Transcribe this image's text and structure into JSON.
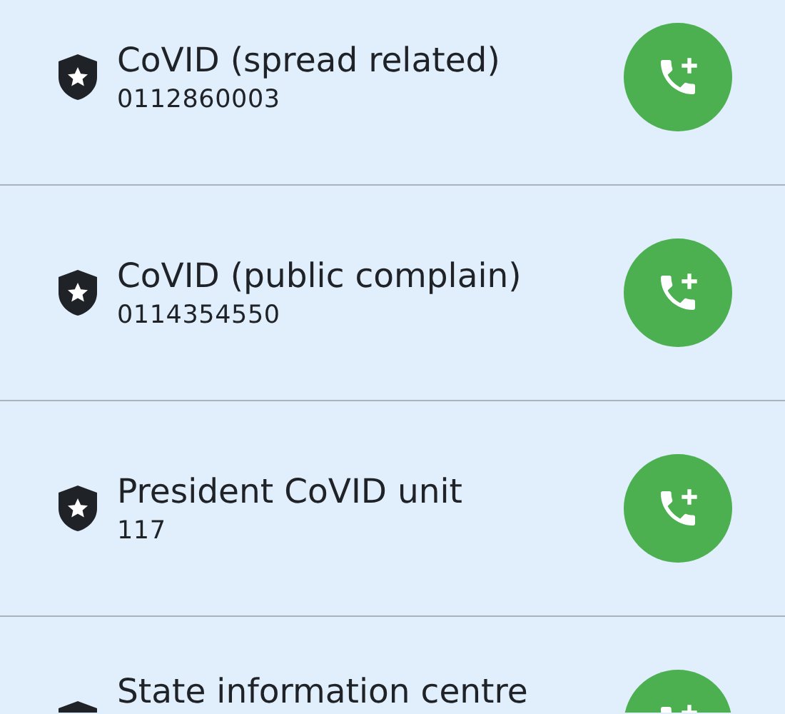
{
  "contacts": [
    {
      "name": "CoVID (spread related)",
      "number": "0112860003"
    },
    {
      "name": "CoVID (public complain)",
      "number": "0114354550"
    },
    {
      "name": "President CoVID unit",
      "number": "117"
    },
    {
      "name": "State information centre"
    }
  ]
}
